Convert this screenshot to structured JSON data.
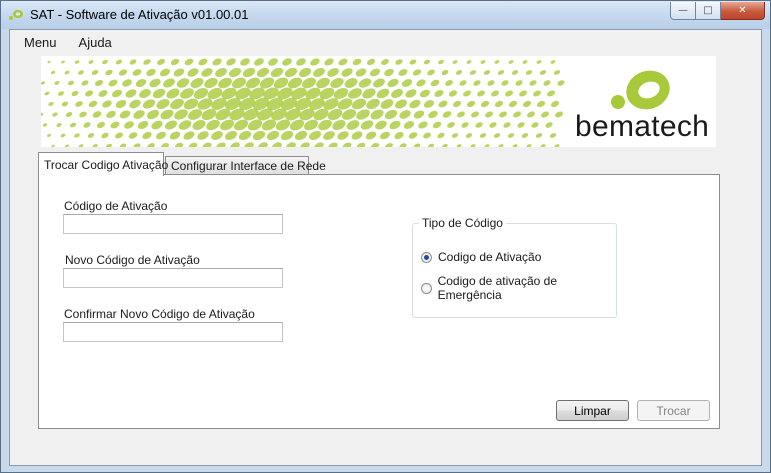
{
  "window": {
    "title": "SAT - Software de Ativação v01.00.01",
    "buttons": {
      "minimize": "—",
      "maximize": "□",
      "close": "✕"
    }
  },
  "menu": [
    {
      "label": "Menu"
    },
    {
      "label": "Ajuda"
    }
  ],
  "banner": {
    "brand": "bematech",
    "brand_color": "#a8c93a"
  },
  "tabs": [
    {
      "label": "Trocar Codigo Ativação",
      "active": true
    },
    {
      "label": "Configurar Interface de Rede",
      "active": false
    }
  ],
  "form": {
    "codigo_ativacao": {
      "label": "Código de Ativação",
      "value": ""
    },
    "novo_codigo": {
      "label": "Novo Código de Ativação",
      "value": ""
    },
    "confirmar_codigo": {
      "label": "Confirmar Novo Código de Ativação",
      "value": ""
    }
  },
  "tipo_codigo": {
    "title": "Tipo de Código",
    "options": [
      {
        "label": "Codigo de Ativação",
        "checked": true
      },
      {
        "label": "Codigo de ativação de Emergência",
        "checked": false
      }
    ]
  },
  "actions": {
    "limpar": "Limpar",
    "trocar": "Trocar"
  }
}
